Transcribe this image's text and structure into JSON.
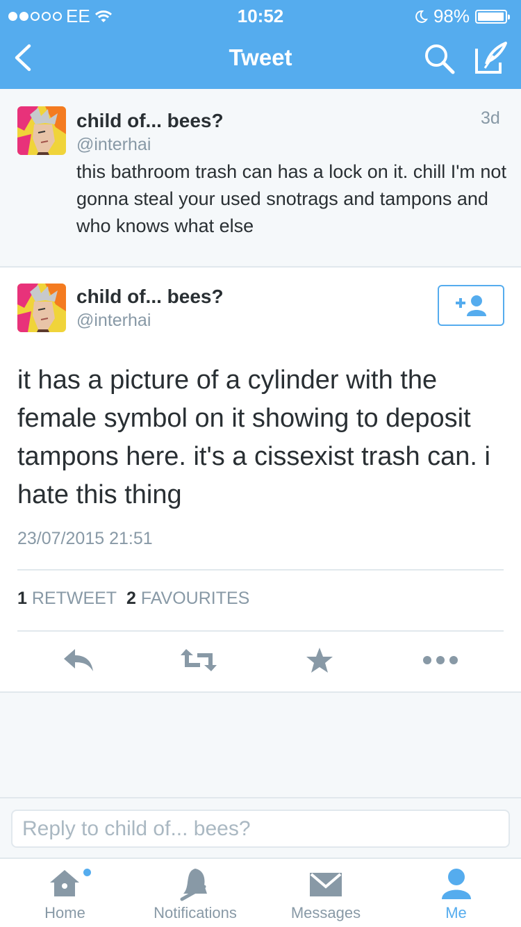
{
  "status_bar": {
    "carrier": "EE",
    "time": "10:52",
    "battery": "98%",
    "battery_level": 0.98
  },
  "nav": {
    "title": "Tweet",
    "icons": [
      "back-icon",
      "search-icon",
      "compose-icon"
    ]
  },
  "prev_tweet": {
    "name": "child of... bees?",
    "handle": "@interhai",
    "age": "3d",
    "text": "this bathroom trash can has a lock on it. chill I'm not gonna steal your used snotrags and tampons and who knows what else"
  },
  "main_tweet": {
    "name": "child of... bees?",
    "handle": "@interhai",
    "text": "it has a picture of a cylinder with the female symbol on it showing to deposit tampons here. it's a cissexist trash can. i hate this thing",
    "timestamp": "23/07/2015 21:51",
    "retweet_count": "1",
    "retweet_label": "RETWEET",
    "favourite_count": "2",
    "favourite_label": "FAVOURITES"
  },
  "reply": {
    "placeholder": "Reply to child of... bees?"
  },
  "tabs": [
    {
      "label": "Home",
      "icon": "home-icon"
    },
    {
      "label": "Notifications",
      "icon": "bell-icon"
    },
    {
      "label": "Messages",
      "icon": "envelope-icon"
    },
    {
      "label": "Me",
      "icon": "person-icon"
    }
  ],
  "colors": {
    "brand": "#55acee",
    "text": "#292f33",
    "muted": "#8899a6",
    "border": "#e1e8ed"
  }
}
